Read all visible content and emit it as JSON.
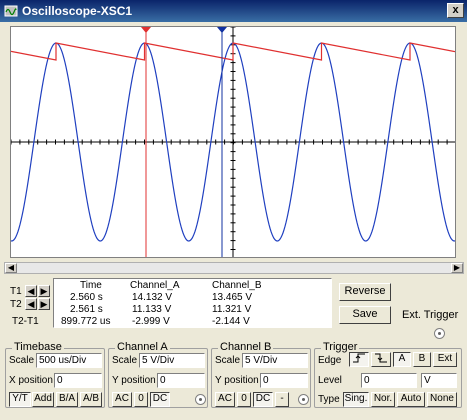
{
  "window": {
    "title": "Oscilloscope-XSC1",
    "close_label": "x"
  },
  "colors": {
    "channel_a": "#E03030",
    "channel_b": "#2040C0",
    "cursor1": "#E03030",
    "cursor2": "#1030A0"
  },
  "readout": {
    "headers": {
      "time": "Time",
      "channel_a": "Channel_A",
      "channel_b": "Channel_B"
    },
    "rows": [
      {
        "label": "T1",
        "time": "2.560 s",
        "a": "14.132 V",
        "b": "13.465 V"
      },
      {
        "label": "T2",
        "time": "2.561 s",
        "a": "11.133 V",
        "b": "11.321 V"
      },
      {
        "label": "T2-T1",
        "time": "899.772 us",
        "a": "-2.999 V",
        "b": "-2.144 V"
      }
    ]
  },
  "buttons": {
    "reverse": "Reverse",
    "save": "Save",
    "ext_trigger": "Ext. Trigger"
  },
  "timebase": {
    "title": "Timebase",
    "scale_label": "Scale",
    "scale_value": "500 us/Div",
    "xpos_label": "X position",
    "xpos_value": "0",
    "modes": [
      "Y/T",
      "Add",
      "B/A",
      "A/B"
    ]
  },
  "channel_a": {
    "title": "Channel A",
    "scale_label": "Scale",
    "scale_value": "5  V/Div",
    "ypos_label": "Y position",
    "ypos_value": "0",
    "coupling": [
      "AC",
      "0",
      "DC"
    ]
  },
  "channel_b": {
    "title": "Channel B",
    "scale_label": "Scale",
    "scale_value": "5  V/Div",
    "ypos_label": "Y position",
    "ypos_value": "0",
    "coupling": [
      "AC",
      "0",
      "DC",
      "-"
    ]
  },
  "trigger": {
    "title": "Trigger",
    "edge_label": "Edge",
    "edge_buttons": [
      "A",
      "B",
      "Ext"
    ],
    "level_label": "Level",
    "level_value": "0",
    "level_unit": "V",
    "type_label": "Type",
    "types": [
      "Sing.",
      "Nor.",
      "Auto",
      "None"
    ]
  }
}
